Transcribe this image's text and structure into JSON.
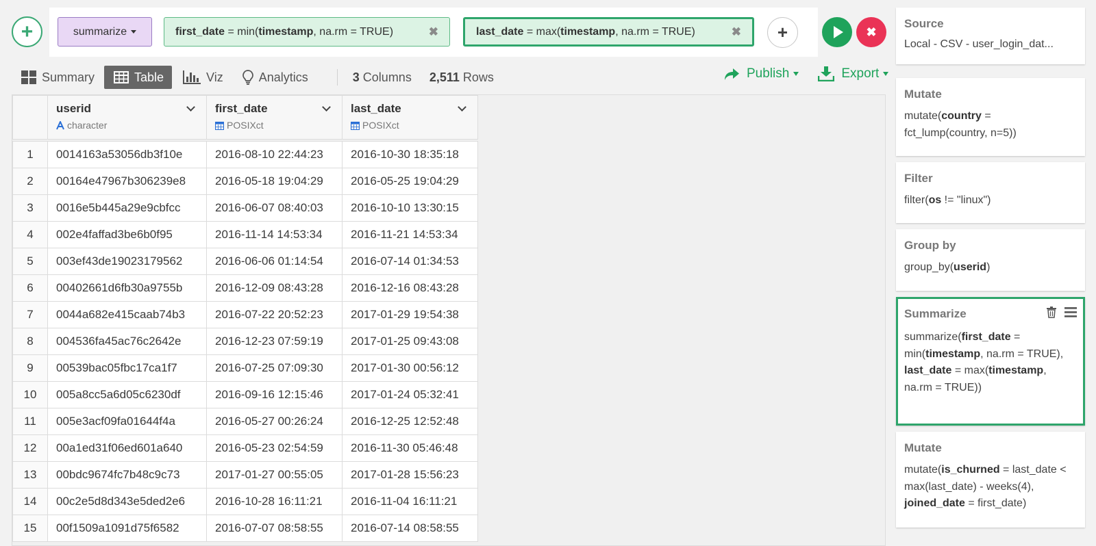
{
  "command": {
    "name": "summarize",
    "args": [
      {
        "name": "first_date",
        "pre": " = min(",
        "col": "timestamp",
        "post": ", na.rm = TRUE)"
      },
      {
        "name": "last_date",
        "pre": " = max(",
        "col": "timestamp",
        "post": ", na.rm = TRUE)"
      }
    ],
    "add_arg_label": "+",
    "add_step_label": "+",
    "cancel_label": "✖"
  },
  "toolbar": {
    "tabs": [
      "Summary",
      "Table",
      "Viz",
      "Analytics"
    ],
    "active_tab": "Table",
    "columns_count": "3",
    "columns_label": "Columns",
    "rows_count": "2,511",
    "rows_label": "Rows",
    "publish_label": "Publish",
    "export_label": "Export"
  },
  "table": {
    "columns": [
      {
        "name": "userid",
        "type": "character",
        "type_icon": "text-type-icon"
      },
      {
        "name": "first_date",
        "type": "POSIXct",
        "type_icon": "calendar-icon"
      },
      {
        "name": "last_date",
        "type": "POSIXct",
        "type_icon": "calendar-icon"
      }
    ],
    "rows": [
      [
        "1",
        "0014163a53056db3f10e",
        "2016-08-10 22:44:23",
        "2016-10-30 18:35:18"
      ],
      [
        "2",
        "00164e47967b306239e8",
        "2016-05-18 19:04:29",
        "2016-05-25 19:04:29"
      ],
      [
        "3",
        "0016e5b445a29e9cbfcc",
        "2016-06-07 08:40:03",
        "2016-10-10 13:30:15"
      ],
      [
        "4",
        "002e4faffad3be6b0f95",
        "2016-11-14 14:53:34",
        "2016-11-21 14:53:34"
      ],
      [
        "5",
        "003ef43de19023179562",
        "2016-06-06 01:14:54",
        "2016-07-14 01:34:53"
      ],
      [
        "6",
        "00402661d6fb30a9755b",
        "2016-12-09 08:43:28",
        "2016-12-16 08:43:28"
      ],
      [
        "7",
        "0044a682e415caab74b3",
        "2016-07-22 20:52:23",
        "2017-01-29 19:54:38"
      ],
      [
        "8",
        "004536fa45ac76c2642e",
        "2016-12-23 07:59:19",
        "2017-01-25 09:43:08"
      ],
      [
        "9",
        "00539bac05fbc17ca1f7",
        "2016-07-25 07:09:30",
        "2017-01-30 00:56:12"
      ],
      [
        "10",
        "005a8cc5a6d05c6230df",
        "2016-09-16 12:15:46",
        "2017-01-24 05:32:41"
      ],
      [
        "11",
        "005e3acf09fa01644f4a",
        "2016-05-27 00:26:24",
        "2016-12-25 12:52:48"
      ],
      [
        "12",
        "00a1ed31f06ed601a640",
        "2016-05-23 02:54:59",
        "2016-11-30 05:46:48"
      ],
      [
        "13",
        "00bdc9674fc7b48c9c73",
        "2017-01-27 00:55:05",
        "2017-01-28 15:56:23"
      ],
      [
        "14",
        "00c2e5d8d343e5ded2e6",
        "2016-10-28 16:11:21",
        "2016-11-04 16:11:21"
      ],
      [
        "15",
        "00f1509a1091d75f6582",
        "2016-07-07 08:58:55",
        "2016-07-14 08:58:55"
      ]
    ]
  },
  "steps": [
    {
      "title": "Source",
      "body": "Local - CSV - user_login_dat..."
    },
    {
      "title": "Mutate"
    },
    {
      "title": "Filter"
    },
    {
      "title": "Group by"
    },
    {
      "title": "Summarize"
    },
    {
      "title": "Mutate"
    }
  ],
  "step_text": {
    "mutate1": {
      "a": "mutate(",
      "b": "country",
      "c": " = fct_lump(country, n=5))"
    },
    "filter": {
      "a": "filter(",
      "b": "os",
      "c": " != \"linux\")"
    },
    "group_by": {
      "a": "group_by(",
      "b": "userid",
      "c": ")"
    },
    "summarize": {
      "a": "summarize(",
      "b": "first_date",
      "c": " = min(",
      "d": "timestamp",
      "e": ", na.rm = TRUE), ",
      "f": "last_date",
      "g": " = max(",
      "h": "timestamp",
      "i": ", na.rm = TRUE))"
    },
    "mutate2": {
      "a": "mutate(",
      "b": "is_churned",
      "c": " = last_date < max(last_date) - weeks(4), ",
      "d": "joined_date",
      "e": " = first_date)"
    }
  },
  "colors": {
    "accent": "#1fa35b",
    "danger": "#ea3356",
    "command_chip": "#e9d8f5",
    "arg_chip": "#dcf3e4"
  }
}
